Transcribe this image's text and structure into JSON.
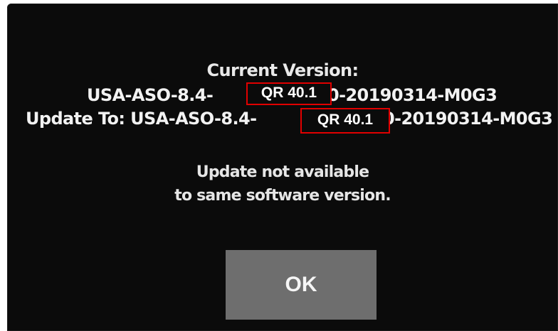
{
  "dialog": {
    "title": "Current Version:",
    "current_version": {
      "prefix": "USA-ASO-8.4-",
      "highlight": "QR 40.1",
      "suffix": "0-20190314-M0G3"
    },
    "update_to": {
      "prefix": "Update To: USA-ASO-8.4-",
      "highlight": "QR 40.1",
      "suffix": "0-20190314-M0G3"
    },
    "message_line1": "Update not available",
    "message_line2": "to same software version.",
    "ok_label": "OK"
  },
  "colors": {
    "screen_background": "#0b0b0b",
    "highlight_border": "#e10000",
    "button_background": "#6e6e6e",
    "text": "#f2f2f2"
  },
  "icons": {
    "cursor": "mouse-pointer-icon"
  }
}
